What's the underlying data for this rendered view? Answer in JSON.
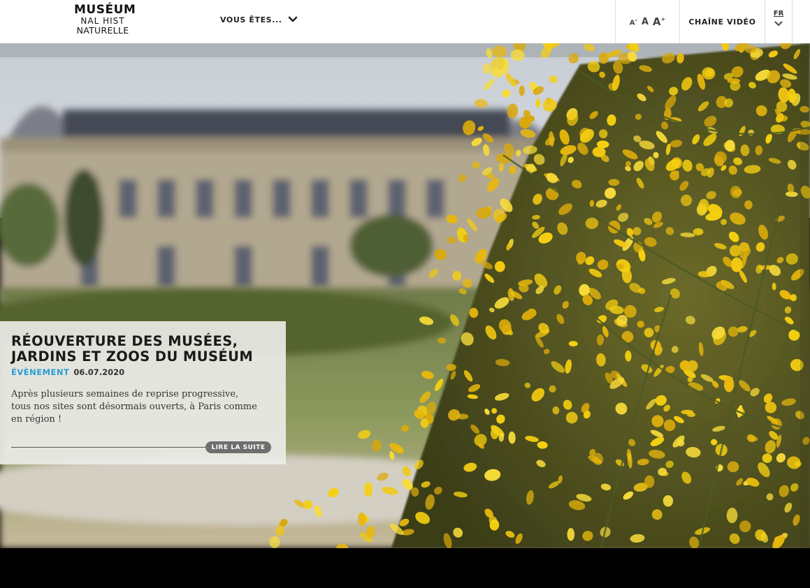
{
  "header": {
    "logo": {
      "line1": "MUSÉUM",
      "line2": "NAL HIST",
      "line3": "NATURELLE"
    },
    "audience_menu_label": "VOUS ÊTES...",
    "font_size_controls": {
      "decrease": "A",
      "reset": "A",
      "increase": "A",
      "minus_sign": "-",
      "plus_sign": "+"
    },
    "video_channel_label": "CHAÎNE VIDÉO",
    "language": "FR"
  },
  "featured": {
    "title": "RÉOUVERTURE DES MUSÉES, JARDINS ET ZOOS DU MUSÉUM",
    "category": "ÉVÈNEMENT",
    "date": "06.07.2020",
    "excerpt": "Après plusieurs semaines de reprise progressive, tous nos sites sont désormais ouverts, à Paris comme en région !",
    "read_more_label": "LIRE LA SUITE"
  },
  "icons": {
    "audience_chevron": "chevron-down-icon",
    "language_chevron": "chevron-down-icon"
  },
  "colors": {
    "accent": "#2a9bd3",
    "flowers": "#f2c811"
  }
}
